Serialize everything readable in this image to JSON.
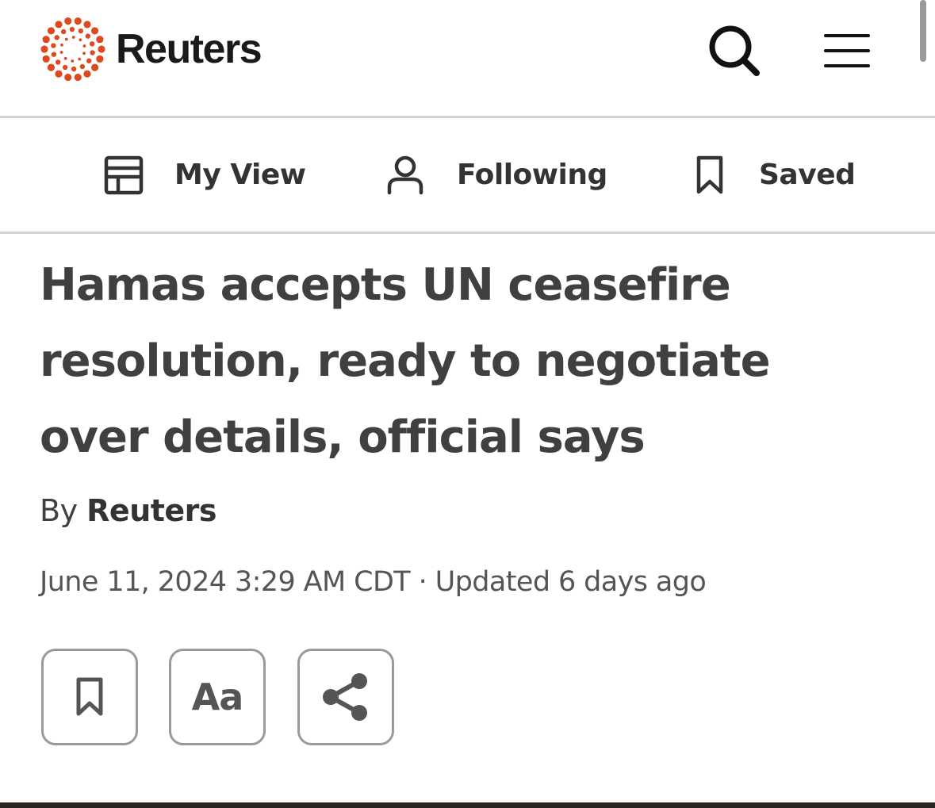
{
  "brand": {
    "name": "Reuters",
    "accent_color": "#dc4a1e"
  },
  "header": {
    "search_icon": "search-icon",
    "menu_icon": "hamburger-menu-icon"
  },
  "subnav": {
    "items": [
      {
        "label": "My View",
        "icon": "layout-grid-icon"
      },
      {
        "label": "Following",
        "icon": "person-icon"
      },
      {
        "label": "Saved",
        "icon": "bookmark-icon"
      }
    ]
  },
  "article": {
    "headline": "Hamas accepts UN ceasefire resolution, ready to negotiate over details, official says",
    "byline_prefix": "By",
    "author": "Reuters",
    "dateline": "June 11, 2024 3:29 AM CDT · Updated 6 days ago"
  },
  "actions": {
    "bookmark_icon": "bookmark-icon",
    "text_size_label": "Aa",
    "share_icon": "share-icon"
  }
}
